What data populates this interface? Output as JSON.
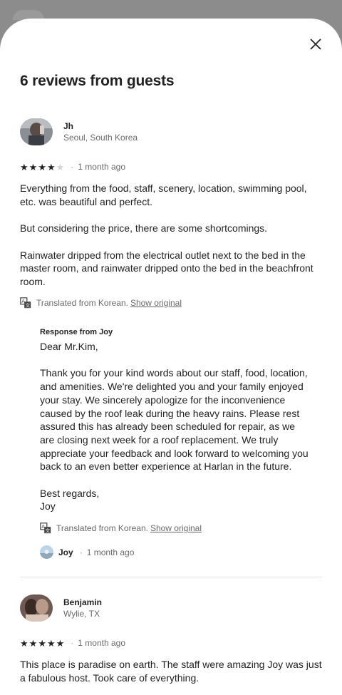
{
  "modal": {
    "title": "6 reviews from guests",
    "close_icon": "close-icon"
  },
  "reviews": [
    {
      "name": "Jh",
      "location": "Seoul, South Korea",
      "rating": 4,
      "date": "1 month ago",
      "text": "Everything from the food, staff, scenery, location, swimming pool, etc. was beautiful and perfect.\n\nBut considering the price, there are some shortcomings.\n\nRainwater dripped from the electrical outlet next to the bed in the master room, and rainwater dripped onto the bed in the beachfront room.",
      "translated_label": "Translated from Korean.",
      "show_original_label": "Show original",
      "response": {
        "heading": "Response from Joy",
        "text": "Dear Mr.Kim,\n\nThank you for your kind words about our staff, food, location, and amenities. We're delighted you and your family enjoyed your stay. We sincerely apologize for the inconvenience caused by the roof leak during the heavy rains. Please rest assured this has already been scheduled for repair, as we are closing next week for a roof replacement. We truly appreciate your feedback and look forward to welcoming you back to an even better experience at Harlan in the future.\n\nBest regards,\nJoy",
        "translated_label": "Translated from Korean.",
        "show_original_label": "Show original",
        "host_name": "Joy",
        "host_date": "1 month ago"
      }
    },
    {
      "name": "Benjamin",
      "location": "Wylie, TX",
      "rating": 5,
      "date": "1 month ago",
      "text": "This place is paradise on earth. The staff were amazing Joy was just a fabulous host. Took care of everything."
    }
  ],
  "separator": "·",
  "colors": {
    "text": "#222222",
    "muted": "#6a6a6a",
    "divider": "#e4e4e4",
    "backdrop": "#8c8c8c"
  }
}
